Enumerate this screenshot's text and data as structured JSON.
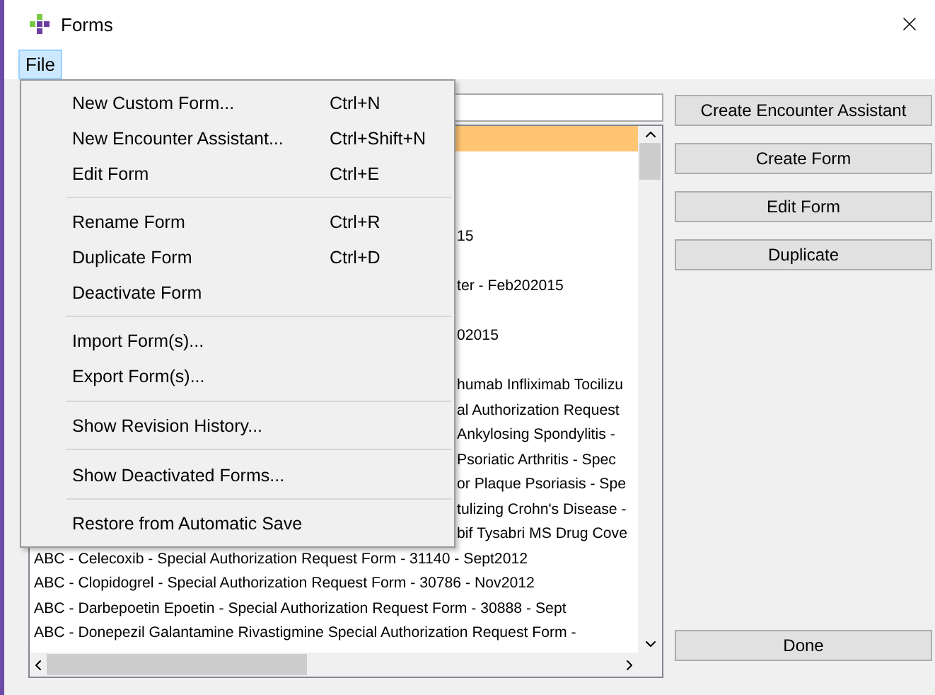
{
  "window": {
    "title": "Forms"
  },
  "menubar": [
    {
      "label": "File",
      "selected": true
    }
  ],
  "menu": [
    {
      "kind": "item",
      "label": "New Custom Form...",
      "shortcut": "Ctrl+N"
    },
    {
      "kind": "item",
      "label": "New Encounter Assistant...",
      "shortcut": "Ctrl+Shift+N"
    },
    {
      "kind": "item",
      "label": "Edit Form",
      "shortcut": "Ctrl+E"
    },
    {
      "kind": "separator"
    },
    {
      "kind": "item",
      "label": "Rename Form",
      "shortcut": "Ctrl+R"
    },
    {
      "kind": "item",
      "label": "Duplicate Form",
      "shortcut": "Ctrl+D"
    },
    {
      "kind": "item",
      "label": "Deactivate Form"
    },
    {
      "kind": "separator"
    },
    {
      "kind": "item",
      "label": "Import Form(s)..."
    },
    {
      "kind": "item",
      "label": "Export Form(s)..."
    },
    {
      "kind": "separator"
    },
    {
      "kind": "item",
      "label": "Show Revision History..."
    },
    {
      "kind": "separator"
    },
    {
      "kind": "item",
      "label": "Show Deactivated Forms..."
    },
    {
      "kind": "separator"
    },
    {
      "kind": "item",
      "label": "Restore from Automatic Save"
    }
  ],
  "forms_list": [
    {
      "kind": "covered",
      "selected": true
    },
    {
      "kind": "covered",
      "selected": false
    },
    {
      "kind": "covered",
      "selected": false
    },
    {
      "kind": "covered",
      "selected": false
    },
    {
      "kind": "covered",
      "text": "15",
      "selected": false
    },
    {
      "kind": "covered",
      "selected": false
    },
    {
      "kind": "covered",
      "text": "ter - Feb202015",
      "selected": false
    },
    {
      "kind": "covered",
      "selected": false
    },
    {
      "kind": "covered",
      "text": "02015",
      "selected": false
    },
    {
      "kind": "covered",
      "selected": false
    },
    {
      "kind": "covered",
      "text": "humab Infliximab Tocilizu",
      "selected": false
    },
    {
      "kind": "covered",
      "text": "al Authorization Request",
      "selected": false
    },
    {
      "kind": "covered",
      "text": "Ankylosing Spondylitis -",
      "selected": false
    },
    {
      "kind": "covered",
      "text": "Psoriatic Arthritis - Spec",
      "selected": false
    },
    {
      "kind": "covered",
      "text": "or Plaque Psoriasis - Spe",
      "selected": false
    },
    {
      "kind": "covered",
      "text": "tulizing Crohn's Disease -",
      "selected": false
    },
    {
      "kind": "covered",
      "text": "bif Tysabri MS Drug Cove",
      "selected": false
    },
    {
      "kind": "full",
      "text": "ABC - Celecoxib - Special Authorization Request Form - 31140 - Sept2012",
      "selected": false
    },
    {
      "kind": "full",
      "text": "ABC - Clopidogrel - Special Authorization Request Form - 30786 - Nov2012",
      "selected": false
    },
    {
      "kind": "full",
      "text": "ABC - Darbepoetin Epoetin - Special Authorization Request Form - 30888 - Sept",
      "selected": false
    },
    {
      "kind": "full",
      "text": "ABC - Donepezil Galantamine Rivastigmine Special Authorization Request Form -",
      "selected": false
    }
  ],
  "buttons": [
    "Create Encounter Assistant",
    "Create Form",
    "Edit Form",
    "Duplicate"
  ],
  "done_button": "Done"
}
